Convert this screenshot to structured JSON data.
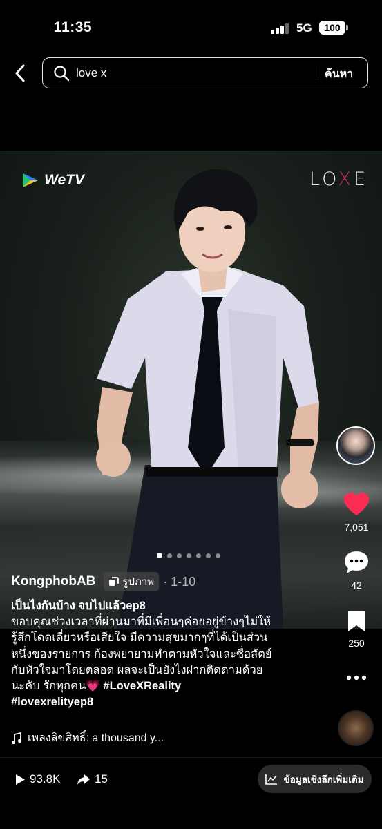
{
  "status": {
    "time": "11:35",
    "network": "5G",
    "battery": "100"
  },
  "search": {
    "query": "love x",
    "submit_label": "ค้นหา"
  },
  "media": {
    "brand_logo": "WeTV",
    "show_logo_left": "LO",
    "show_logo_x": "X",
    "show_logo_right": "E",
    "total_slides": 7,
    "current_slide": 1
  },
  "post": {
    "author": "KongphobAB",
    "photo_tag": "รูปภาพ",
    "photo_count": "· 1-10",
    "caption_title": "เป็นไงกันบ้าง จบไปแล้วep8",
    "caption_lines": [
      "ขอบคุณช่วงเวลาที่ผ่านมาที่มีเพื่อนๆค่อยอยู่ข้างๆไม่ให้",
      "รู้สึกโดดเดี่ยวหรือเสียใจ มีความสุขมากๆที่ได้เป็นส่วน",
      "หนึ่งของรายการ ก้องพยายามทำตามหัวใจและซื่อสัตย์",
      "กับหัวใจมาโดยตลอด ผลจะเป็นยังไงฝากติดตามด้วย"
    ],
    "caption_last": "นะคับ รักทุกคน",
    "heart_emoji": "💗",
    "hashtag_1": "#LoveXReality",
    "hashtag_2": "#lovexrelityep8",
    "music_label": "เพลงลิขสิทธิ์: a thousand y..."
  },
  "actions": {
    "likes": "7,051",
    "comments": "42",
    "saves": "250"
  },
  "bottom": {
    "views": "93.8K",
    "shares": "15",
    "insights_label": "ข้อมูลเชิงลึกเพิ่มเติม"
  },
  "colors": {
    "like": "#fe2c55",
    "show_accent": "#d42a6d",
    "wetv_green": "#1cc46a",
    "wetv_blue": "#2b80ff"
  }
}
